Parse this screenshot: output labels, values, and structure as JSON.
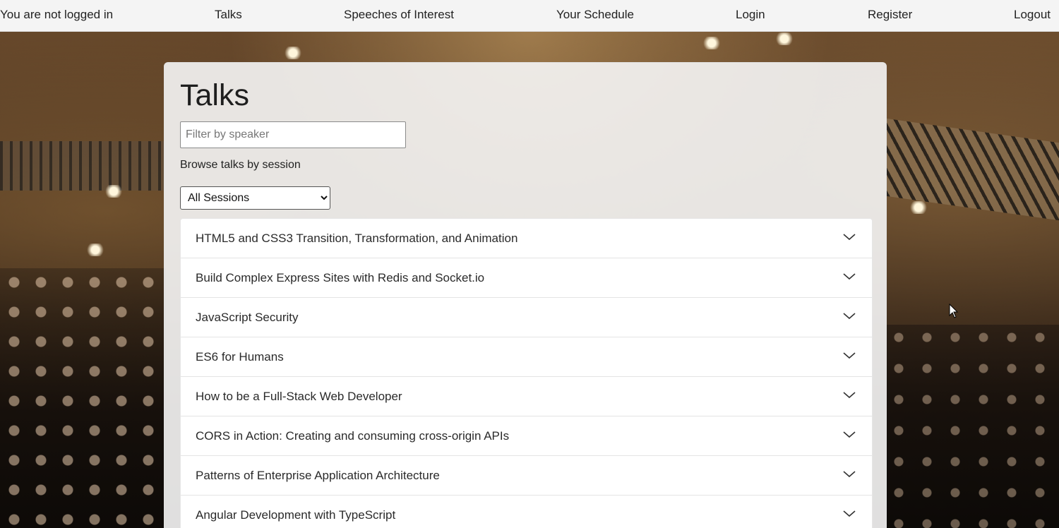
{
  "nav": {
    "status": "You are not logged in",
    "talks": "Talks",
    "speeches": "Speeches of Interest",
    "schedule": "Your Schedule",
    "login": "Login",
    "register": "Register",
    "logout": "Logout"
  },
  "main": {
    "title": "Talks",
    "filter_placeholder": "Filter by speaker",
    "browse_label": "Browse talks by session",
    "session_select": {
      "selected": "All Sessions",
      "options": [
        "All Sessions"
      ]
    },
    "talks": [
      {
        "title": "HTML5 and CSS3 Transition, Transformation, and Animation"
      },
      {
        "title": "Build Complex Express Sites with Redis and Socket.io"
      },
      {
        "title": "JavaScript Security"
      },
      {
        "title": "ES6 for Humans"
      },
      {
        "title": "How to be a Full-Stack Web Developer"
      },
      {
        "title": "CORS in Action: Creating and consuming cross-origin APIs"
      },
      {
        "title": "Patterns of Enterprise Application Architecture"
      },
      {
        "title": "Angular Development with TypeScript"
      }
    ]
  },
  "icons": {
    "expand": "chevron-down-icon",
    "cursor": "mouse-pointer-icon"
  },
  "colors": {
    "nav_bg": "#f4f4f4",
    "text": "#222222",
    "panel_bg": "#f6f6f6"
  }
}
